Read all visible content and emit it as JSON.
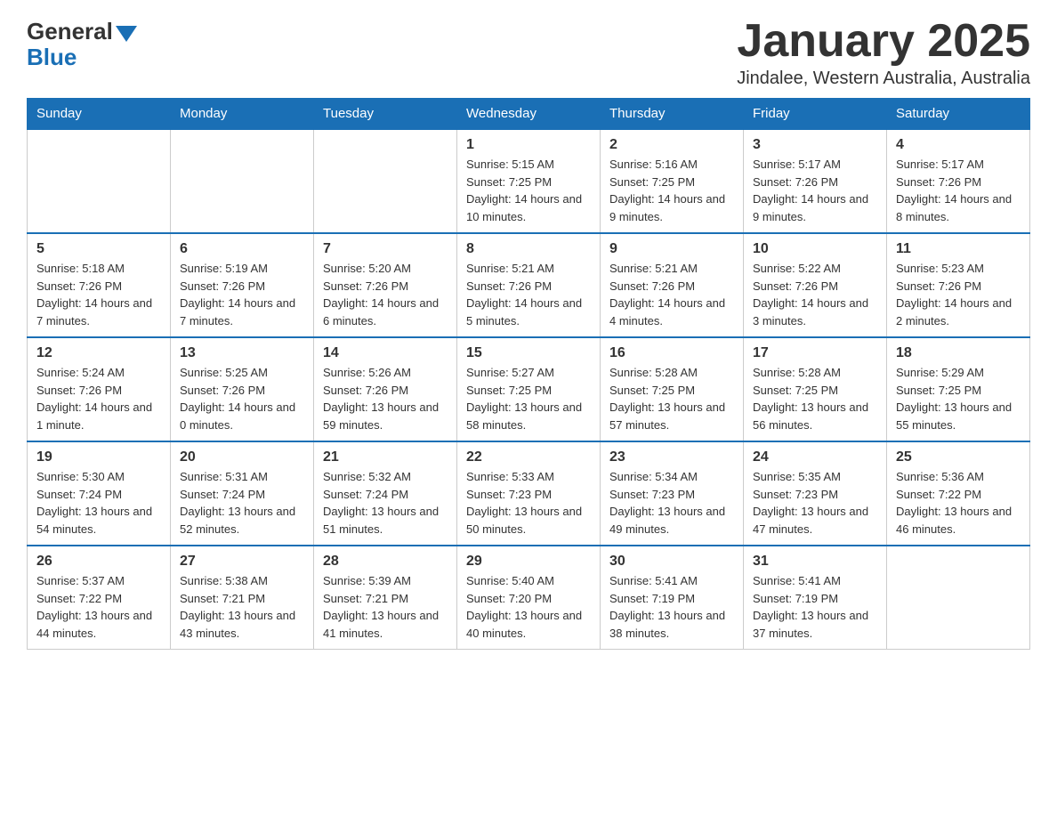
{
  "header": {
    "logo": {
      "general": "General",
      "blue": "Blue"
    },
    "title": "January 2025",
    "location": "Jindalee, Western Australia, Australia"
  },
  "calendar": {
    "days_of_week": [
      "Sunday",
      "Monday",
      "Tuesday",
      "Wednesday",
      "Thursday",
      "Friday",
      "Saturday"
    ],
    "weeks": [
      [
        {
          "day": "",
          "info": ""
        },
        {
          "day": "",
          "info": ""
        },
        {
          "day": "",
          "info": ""
        },
        {
          "day": "1",
          "info": "Sunrise: 5:15 AM\nSunset: 7:25 PM\nDaylight: 14 hours and 10 minutes."
        },
        {
          "day": "2",
          "info": "Sunrise: 5:16 AM\nSunset: 7:25 PM\nDaylight: 14 hours and 9 minutes."
        },
        {
          "day": "3",
          "info": "Sunrise: 5:17 AM\nSunset: 7:26 PM\nDaylight: 14 hours and 9 minutes."
        },
        {
          "day": "4",
          "info": "Sunrise: 5:17 AM\nSunset: 7:26 PM\nDaylight: 14 hours and 8 minutes."
        }
      ],
      [
        {
          "day": "5",
          "info": "Sunrise: 5:18 AM\nSunset: 7:26 PM\nDaylight: 14 hours and 7 minutes."
        },
        {
          "day": "6",
          "info": "Sunrise: 5:19 AM\nSunset: 7:26 PM\nDaylight: 14 hours and 7 minutes."
        },
        {
          "day": "7",
          "info": "Sunrise: 5:20 AM\nSunset: 7:26 PM\nDaylight: 14 hours and 6 minutes."
        },
        {
          "day": "8",
          "info": "Sunrise: 5:21 AM\nSunset: 7:26 PM\nDaylight: 14 hours and 5 minutes."
        },
        {
          "day": "9",
          "info": "Sunrise: 5:21 AM\nSunset: 7:26 PM\nDaylight: 14 hours and 4 minutes."
        },
        {
          "day": "10",
          "info": "Sunrise: 5:22 AM\nSunset: 7:26 PM\nDaylight: 14 hours and 3 minutes."
        },
        {
          "day": "11",
          "info": "Sunrise: 5:23 AM\nSunset: 7:26 PM\nDaylight: 14 hours and 2 minutes."
        }
      ],
      [
        {
          "day": "12",
          "info": "Sunrise: 5:24 AM\nSunset: 7:26 PM\nDaylight: 14 hours and 1 minute."
        },
        {
          "day": "13",
          "info": "Sunrise: 5:25 AM\nSunset: 7:26 PM\nDaylight: 14 hours and 0 minutes."
        },
        {
          "day": "14",
          "info": "Sunrise: 5:26 AM\nSunset: 7:26 PM\nDaylight: 13 hours and 59 minutes."
        },
        {
          "day": "15",
          "info": "Sunrise: 5:27 AM\nSunset: 7:25 PM\nDaylight: 13 hours and 58 minutes."
        },
        {
          "day": "16",
          "info": "Sunrise: 5:28 AM\nSunset: 7:25 PM\nDaylight: 13 hours and 57 minutes."
        },
        {
          "day": "17",
          "info": "Sunrise: 5:28 AM\nSunset: 7:25 PM\nDaylight: 13 hours and 56 minutes."
        },
        {
          "day": "18",
          "info": "Sunrise: 5:29 AM\nSunset: 7:25 PM\nDaylight: 13 hours and 55 minutes."
        }
      ],
      [
        {
          "day": "19",
          "info": "Sunrise: 5:30 AM\nSunset: 7:24 PM\nDaylight: 13 hours and 54 minutes."
        },
        {
          "day": "20",
          "info": "Sunrise: 5:31 AM\nSunset: 7:24 PM\nDaylight: 13 hours and 52 minutes."
        },
        {
          "day": "21",
          "info": "Sunrise: 5:32 AM\nSunset: 7:24 PM\nDaylight: 13 hours and 51 minutes."
        },
        {
          "day": "22",
          "info": "Sunrise: 5:33 AM\nSunset: 7:23 PM\nDaylight: 13 hours and 50 minutes."
        },
        {
          "day": "23",
          "info": "Sunrise: 5:34 AM\nSunset: 7:23 PM\nDaylight: 13 hours and 49 minutes."
        },
        {
          "day": "24",
          "info": "Sunrise: 5:35 AM\nSunset: 7:23 PM\nDaylight: 13 hours and 47 minutes."
        },
        {
          "day": "25",
          "info": "Sunrise: 5:36 AM\nSunset: 7:22 PM\nDaylight: 13 hours and 46 minutes."
        }
      ],
      [
        {
          "day": "26",
          "info": "Sunrise: 5:37 AM\nSunset: 7:22 PM\nDaylight: 13 hours and 44 minutes."
        },
        {
          "day": "27",
          "info": "Sunrise: 5:38 AM\nSunset: 7:21 PM\nDaylight: 13 hours and 43 minutes."
        },
        {
          "day": "28",
          "info": "Sunrise: 5:39 AM\nSunset: 7:21 PM\nDaylight: 13 hours and 41 minutes."
        },
        {
          "day": "29",
          "info": "Sunrise: 5:40 AM\nSunset: 7:20 PM\nDaylight: 13 hours and 40 minutes."
        },
        {
          "day": "30",
          "info": "Sunrise: 5:41 AM\nSunset: 7:19 PM\nDaylight: 13 hours and 38 minutes."
        },
        {
          "day": "31",
          "info": "Sunrise: 5:41 AM\nSunset: 7:19 PM\nDaylight: 13 hours and 37 minutes."
        },
        {
          "day": "",
          "info": ""
        }
      ]
    ]
  }
}
